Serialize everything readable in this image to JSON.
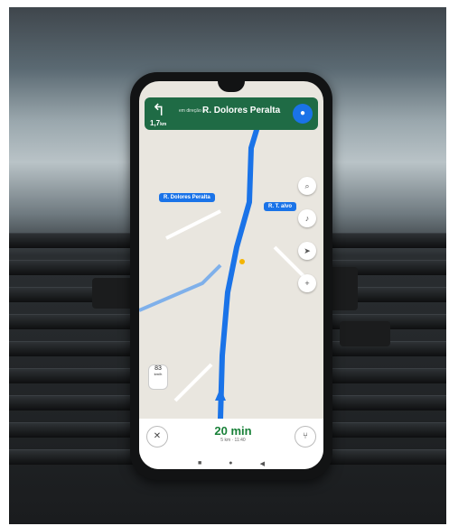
{
  "nav": {
    "turn_arrow": "↰",
    "distance": "1,7",
    "distance_unit": "km",
    "toward": "em direção à",
    "street": "R. Dolores Peralta",
    "mic_icon": "microphone-icon"
  },
  "map": {
    "label_street": "R. Dolores Peralta",
    "label_right": "R. T. alvo",
    "fab_icons": [
      "search-icon",
      "volume-icon",
      "compass-icon",
      "report-icon"
    ]
  },
  "speed": {
    "value": "83",
    "unit": "km/h"
  },
  "bottom": {
    "eta": "20 min",
    "eta_sub": "5 km · 11:40",
    "close_icon": "close-icon",
    "routes_icon": "routes-icon"
  },
  "colors": {
    "nav_green": "#1f6b45",
    "route_blue": "#1a73e8",
    "eta_green": "#188038"
  }
}
